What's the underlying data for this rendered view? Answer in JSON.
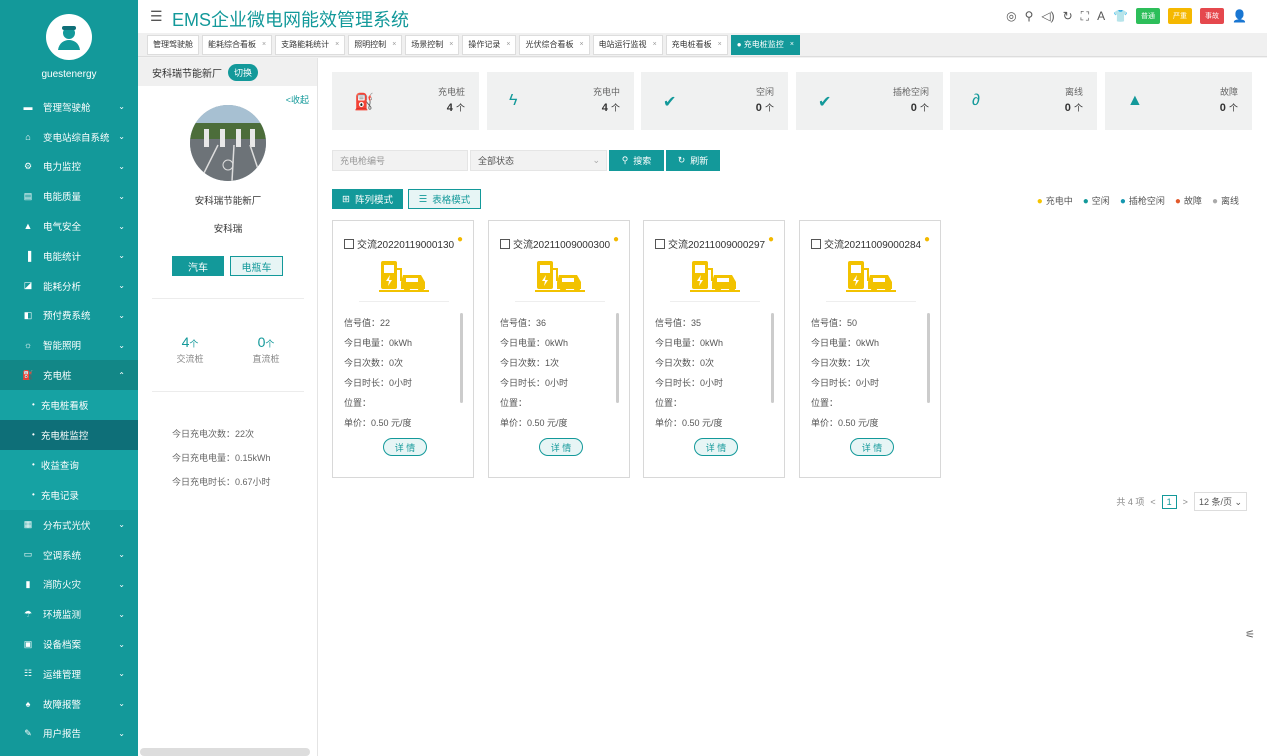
{
  "app": {
    "title": "EMS企业微电网能效管理系统"
  },
  "user": {
    "name": "guestenergy"
  },
  "header_badges": [
    {
      "label": "普通",
      "color": "#2dbe5a"
    },
    {
      "label": "严重",
      "color": "#f5b800"
    },
    {
      "label": "事故",
      "color": "#e5484d"
    }
  ],
  "sidebar": {
    "items": [
      {
        "label": "管理驾驶舱",
        "icon": "monitor-icon",
        "glyph": "▬"
      },
      {
        "label": "变电站综自系统",
        "icon": "home-icon",
        "glyph": "⌂"
      },
      {
        "label": "电力监控",
        "icon": "power-icon",
        "glyph": "⚙"
      },
      {
        "label": "电能质量",
        "icon": "database-icon",
        "glyph": "▤"
      },
      {
        "label": "电气安全",
        "icon": "shield-icon",
        "glyph": "▲"
      },
      {
        "label": "电能统计",
        "icon": "bar-chart-icon",
        "glyph": "▐"
      },
      {
        "label": "能耗分析",
        "icon": "area-chart-icon",
        "glyph": "◪"
      },
      {
        "label": "预付费系统",
        "icon": "payment-icon",
        "glyph": "◧"
      },
      {
        "label": "智能照明",
        "icon": "bulb-icon",
        "glyph": "☼"
      },
      {
        "label": "充电桩",
        "icon": "charger-icon",
        "glyph": "⛽"
      }
    ],
    "subitems": [
      {
        "label": "充电桩看板"
      },
      {
        "label": "充电桩监控"
      },
      {
        "label": "收益查询"
      },
      {
        "label": "充电记录"
      }
    ],
    "items2": [
      {
        "label": "分布式光伏",
        "icon": "solar-icon",
        "glyph": "▦"
      },
      {
        "label": "空调系统",
        "icon": "aircon-icon",
        "glyph": "▭"
      },
      {
        "label": "消防火灾",
        "icon": "extinguisher-icon",
        "glyph": "▮"
      },
      {
        "label": "环境监测",
        "icon": "environment-icon",
        "glyph": "☂"
      },
      {
        "label": "设备档案",
        "icon": "archive-icon",
        "glyph": "▣"
      },
      {
        "label": "运维管理",
        "icon": "maintenance-icon",
        "glyph": "☷"
      },
      {
        "label": "故障报警",
        "icon": "alarm-icon",
        "glyph": "♠"
      },
      {
        "label": "用户报告",
        "icon": "report-icon",
        "glyph": "✎"
      }
    ]
  },
  "tabs": [
    {
      "label": "管理驾驶舱"
    },
    {
      "label": "能耗综合看板",
      "close": "×"
    },
    {
      "label": "支路能耗统计",
      "close": "×"
    },
    {
      "label": "照明控制",
      "close": "×"
    },
    {
      "label": "场景控制",
      "close": "×"
    },
    {
      "label": "操作记录",
      "close": "×"
    },
    {
      "label": "光伏综合看板",
      "close": "×"
    },
    {
      "label": "电站运行监视",
      "close": "×"
    },
    {
      "label": "充电桩看板",
      "close": "×"
    },
    {
      "label": "● 充电桩监控",
      "close": "×"
    }
  ],
  "left": {
    "site": "安科瑞节能新厂",
    "switch": "切换",
    "collapse": "<收起",
    "site_name": "安科瑞节能新厂",
    "company": "安科瑞",
    "btn_car": "汽车",
    "btn_ebike": "电瓶车",
    "ac_count": "4",
    "ac_unit": "个",
    "ac_label": "交流桩",
    "dc_count": "0",
    "dc_unit": "个",
    "dc_label": "直流桩",
    "today_times": "今日充电次数：22次",
    "today_energy": "今日充电电量：0.15kWh",
    "today_duration": "今日充电时长：0.67小时"
  },
  "stats": [
    {
      "label": "充电桩",
      "value": "4",
      "unit": "个",
      "icon": "charger-icon",
      "glyph": "⛽"
    },
    {
      "label": "充电中",
      "value": "4",
      "unit": "个",
      "icon": "lightning-icon",
      "glyph": "ϟ"
    },
    {
      "label": "空闲",
      "value": "0",
      "unit": "个",
      "icon": "check-circle-icon",
      "glyph": "✔"
    },
    {
      "label": "插枪空闲",
      "value": "0",
      "unit": "个",
      "icon": "check-circle-icon",
      "glyph": "✔"
    },
    {
      "label": "离线",
      "value": "0",
      "unit": "个",
      "icon": "plug-icon",
      "glyph": "∂"
    },
    {
      "label": "故障",
      "value": "0",
      "unit": "个",
      "icon": "warning-icon",
      "glyph": "▲"
    }
  ],
  "search": {
    "placeholder": "充电枪编号",
    "status": "全部状态",
    "search_btn": "搜索",
    "refresh_btn": "刷新"
  },
  "modes": {
    "grid": "阵列模式",
    "table": "表格模式"
  },
  "legend": [
    {
      "label": "充电中",
      "color": "#f5c400"
    },
    {
      "label": "空闲",
      "color": "#13999a"
    },
    {
      "label": "插枪空闲",
      "color": "#1597b0"
    },
    {
      "label": "故障",
      "color": "#e25a2c"
    },
    {
      "label": "离线",
      "color": "#aaaaaa"
    }
  ],
  "cards": [
    {
      "id": "交流20220119000130",
      "signal": "信号值：22",
      "energy": "今日电量：0kWh",
      "times": "今日次数：0次",
      "duration": "今日时长：0小时",
      "location": "位置：",
      "price": "单价：0.50 元/度",
      "detail": "详 情"
    },
    {
      "id": "交流20211009000300",
      "signal": "信号值：36",
      "energy": "今日电量：0kWh",
      "times": "今日次数：1次",
      "duration": "今日时长：0小时",
      "location": "位置：",
      "price": "单价：0.50 元/度",
      "detail": "详 情"
    },
    {
      "id": "交流20211009000297",
      "signal": "信号值：35",
      "energy": "今日电量：0kWh",
      "times": "今日次数：0次",
      "duration": "今日时长：0小时",
      "location": "位置：",
      "price": "单价：0.50 元/度",
      "detail": "详 情"
    },
    {
      "id": "交流20211009000284",
      "signal": "信号值：50",
      "energy": "今日电量：0kWh",
      "times": "今日次数：1次",
      "duration": "今日时长：0小时",
      "location": "位置：",
      "price": "单价：0.50 元/度",
      "detail": "详 情"
    }
  ],
  "pager": {
    "total": "共 4 项",
    "page": "1",
    "size": "12 条/页"
  }
}
